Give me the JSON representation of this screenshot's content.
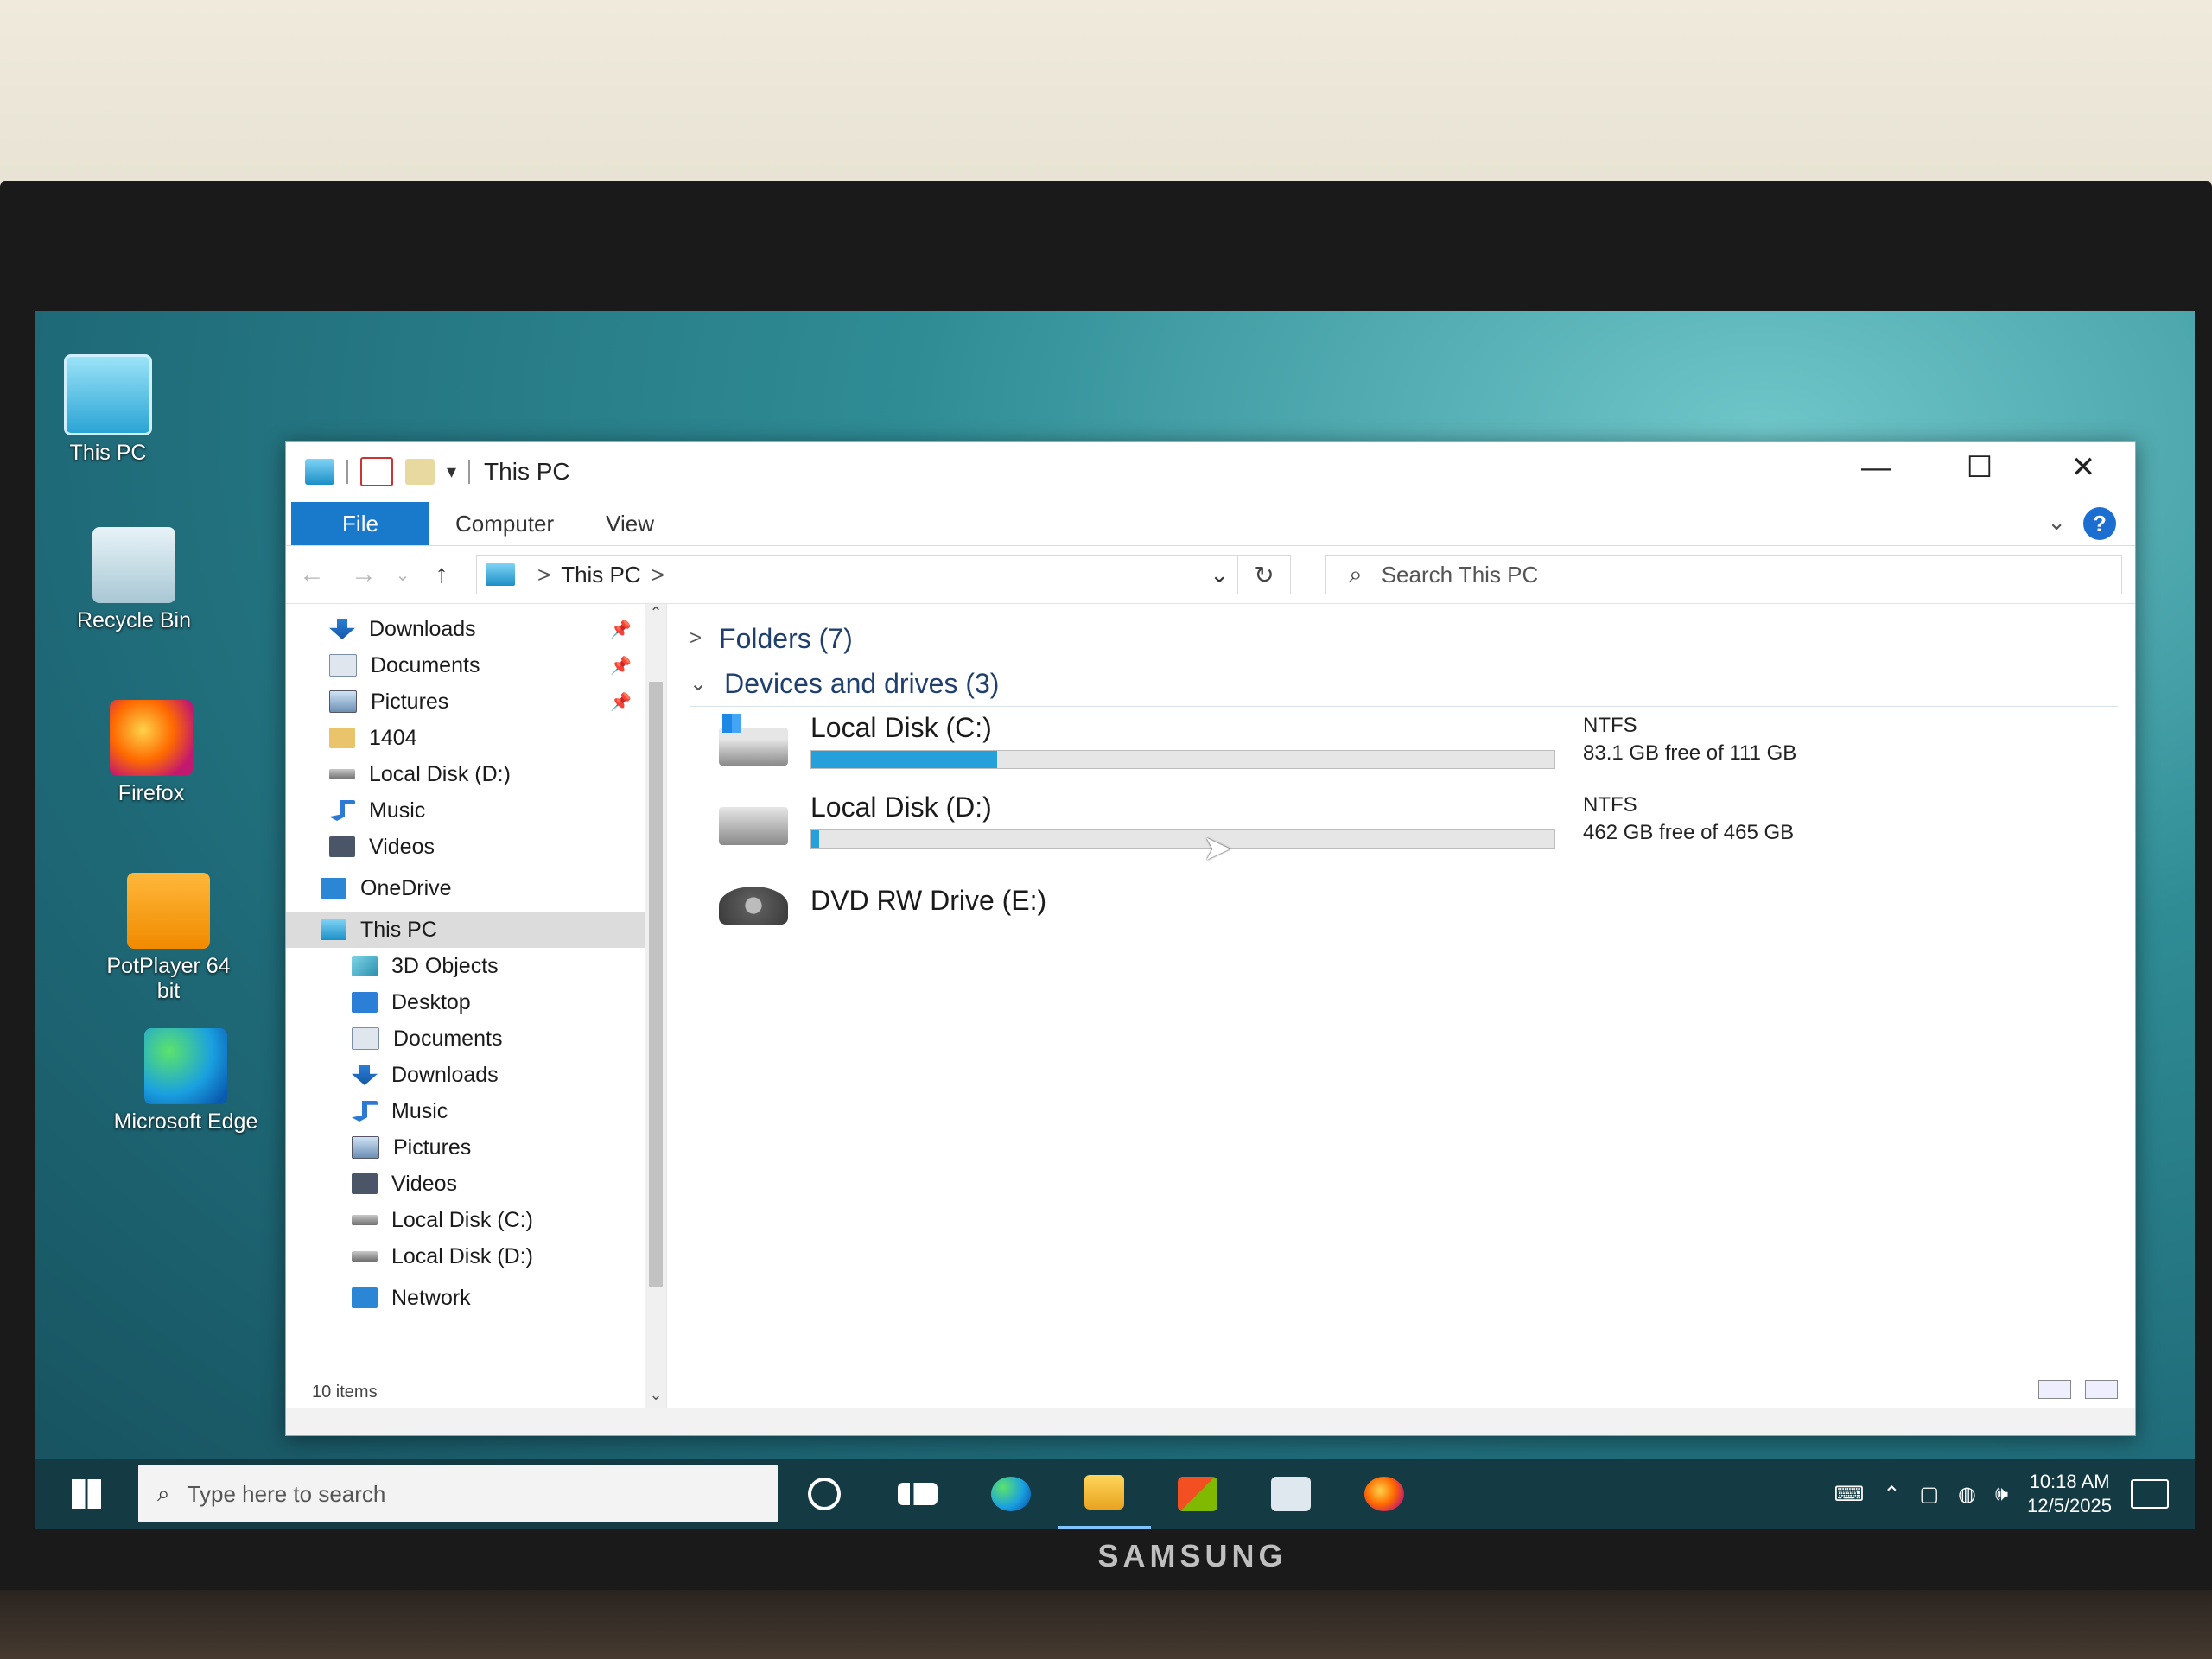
{
  "desktop": {
    "icons": [
      {
        "label": "This PC",
        "icon": "this-pc-icon"
      },
      {
        "label": "Recycle Bin",
        "icon": "recycle-bin-icon"
      },
      {
        "label": "Firefox",
        "icon": "firefox-icon"
      },
      {
        "label": "PotPlayer 64 bit",
        "icon": "potplayer-icon"
      },
      {
        "label": "Microsoft Edge",
        "icon": "edge-icon"
      }
    ]
  },
  "window": {
    "title": "This PC",
    "controls": {
      "minimize": "—",
      "maximize": "☐",
      "close": "✕"
    },
    "ribbon_tabs": [
      "File",
      "Computer",
      "View"
    ],
    "help": "?",
    "address": {
      "root": "This PC",
      "separator": ">"
    },
    "search_placeholder": "Search This PC",
    "nav_items": [
      {
        "label": "Downloads",
        "icon": "downloads-icon",
        "pinned": true
      },
      {
        "label": "Documents",
        "icon": "documents-icon",
        "pinned": true
      },
      {
        "label": "Pictures",
        "icon": "pictures-icon",
        "pinned": true
      },
      {
        "label": "1404",
        "icon": "folder-icon",
        "pinned": false
      },
      {
        "label": "Local Disk (D:)",
        "icon": "disk-icon",
        "pinned": false
      },
      {
        "label": "Music",
        "icon": "music-icon",
        "pinned": false
      },
      {
        "label": "Videos",
        "icon": "videos-icon",
        "pinned": false
      },
      {
        "label": "OneDrive",
        "icon": "onedrive-icon",
        "pinned": false
      },
      {
        "label": "This PC",
        "icon": "this-pc-icon",
        "pinned": false,
        "selected": true
      },
      {
        "label": "3D Objects",
        "icon": "3d-objects-icon",
        "pinned": false
      },
      {
        "label": "Desktop",
        "icon": "desktop-icon",
        "pinned": false
      },
      {
        "label": "Documents",
        "icon": "documents-icon",
        "pinned": false
      },
      {
        "label": "Downloads",
        "icon": "downloads-icon",
        "pinned": false
      },
      {
        "label": "Music",
        "icon": "music-icon",
        "pinned": false
      },
      {
        "label": "Pictures",
        "icon": "pictures-icon",
        "pinned": false
      },
      {
        "label": "Videos",
        "icon": "videos-icon",
        "pinned": false
      },
      {
        "label": "Local Disk (C:)",
        "icon": "disk-icon",
        "pinned": false
      },
      {
        "label": "Local Disk (D:)",
        "icon": "disk-icon",
        "pinned": false
      },
      {
        "label": "Network",
        "icon": "network-icon",
        "pinned": false
      }
    ],
    "status": "10 items",
    "groups": {
      "folders": "Folders (7)",
      "devices": "Devices and drives (3)"
    },
    "drives": [
      {
        "name": "Local Disk (C:)",
        "fs": "NTFS",
        "free": "83.1 GB free of 111 GB",
        "used_fraction": 0.25
      },
      {
        "name": "Local Disk (D:)",
        "fs": "NTFS",
        "free": "462 GB free of 465 GB",
        "used_fraction": 0.01
      },
      {
        "name": "DVD RW Drive (E:)"
      }
    ]
  },
  "taskbar": {
    "search_placeholder": "Type here to search",
    "time": "10:18 AM",
    "date": "12/5/2025",
    "apps": [
      "cortana-icon",
      "task-view-icon",
      "edge-icon",
      "file-explorer-icon",
      "store-icon",
      "mail-icon",
      "firefox-icon"
    ]
  },
  "monitor": {
    "brand": "SAMSUNG"
  },
  "colors": {
    "accent": "#1979ca",
    "drive_bar": "#26a0da",
    "taskbar": "#143b43"
  }
}
